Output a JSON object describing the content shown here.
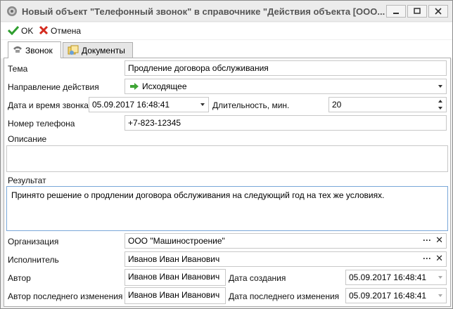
{
  "window": {
    "title": "Новый объект \"Телефонный звонок\" в справочнике \"Действия объекта [ООО..."
  },
  "toolbar": {
    "ok_label": "OK",
    "cancel_label": "Отмена"
  },
  "tabs": [
    {
      "label": "Звонок",
      "active": true
    },
    {
      "label": "Документы",
      "active": false
    }
  ],
  "form": {
    "topic_label": "Тема",
    "topic_value": "Продление договора обслуживания",
    "direction_label": "Направление действия",
    "direction_value": "Исходящее",
    "datetime_label": "Дата и время звонка",
    "datetime_value": "05.09.2017 16:48:41",
    "duration_label": "Длительность, мин.",
    "duration_value": "20",
    "phone_label": "Номер телефона",
    "phone_value": "+7-823-12345",
    "description_label": "Описание",
    "description_value": "",
    "result_label": "Результат",
    "result_value": "Принято решение о продлении договора обслуживания на следующий год на тех же условиях.",
    "organization_label": "Организация",
    "organization_value": "ООО \"Машиностроение\"",
    "executor_label": "Исполнитель",
    "executor_value": "Иванов Иван Иванович",
    "author_label": "Автор",
    "author_value": "Иванов Иван Иванович",
    "created_label": "Дата создания",
    "created_value": "05.09.2017 16:48:41",
    "last_author_label": "Автор последнего изменения",
    "last_author_value": "Иванов Иван Иванович",
    "modified_label": "Дата последнего изменения",
    "modified_value": "05.09.2017 16:48:41",
    "select_dots": "···",
    "clear_x": "✕"
  },
  "icons": {
    "app": "app-icon",
    "ok": "checkmark-icon",
    "cancel": "red-x-icon",
    "tab_call": "phone-icon",
    "tab_docs": "documents-icon",
    "direction": "green-arrow-icon"
  },
  "colors": {
    "ok_green": "#2e9e2e",
    "cancel_red": "#d42a1e",
    "arrow_green": "#3fa535"
  }
}
